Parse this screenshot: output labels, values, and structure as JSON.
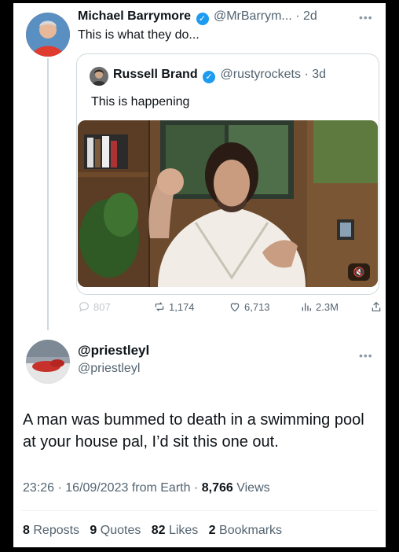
{
  "main_tweet": {
    "author_name": "Michael Barrymore",
    "handle": "@MrBarrym...",
    "time": "2d",
    "text": "This is what they do..."
  },
  "quoted_tweet": {
    "author_name": "Russell Brand",
    "handle": "@rustyrockets",
    "time": "3d",
    "text": "This is happening"
  },
  "actions": {
    "replies": "807",
    "reposts": "1,174",
    "likes": "6,713",
    "views": "2.3M"
  },
  "reply_tweet": {
    "author_name": "@priestleyl",
    "handle": "@priestleyl",
    "text": "A man was bummed to death in a swimming pool at your house pal, I’d sit this one out."
  },
  "meta": {
    "time": "23:26",
    "date": "16/09/2023",
    "source": "from Earth",
    "views_count": "8,766",
    "views_label": "Views"
  },
  "stats": {
    "reposts_count": "8",
    "reposts_label": "Reposts",
    "quotes_count": "9",
    "quotes_label": "Quotes",
    "likes_count": "82",
    "likes_label": "Likes",
    "bookmarks_count": "2",
    "bookmarks_label": "Bookmarks"
  },
  "icons": [
    "verified-badge-icon",
    "more-icon",
    "reply-icon",
    "repost-icon",
    "like-icon",
    "views-icon",
    "share-icon",
    "mute-icon"
  ],
  "colors": {
    "verified": "#1d9bf0",
    "muted_text": "#536471",
    "border": "#cfd9de"
  }
}
